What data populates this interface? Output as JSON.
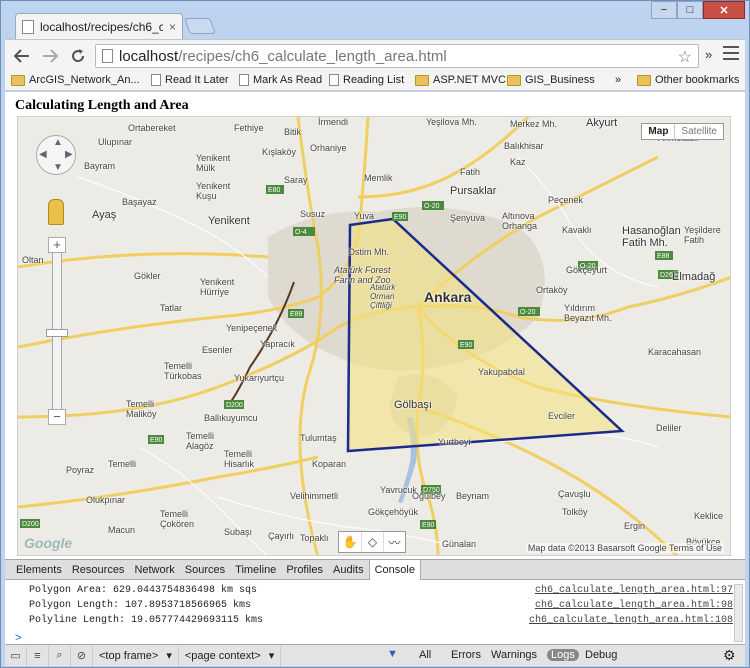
{
  "browser": {
    "tab_title": "localhost/recipes/ch6_calc",
    "tab_close": "×",
    "url_host": "localhost",
    "url_path": "/recipes/ch6_calculate_length_area.html",
    "win_min": "−",
    "win_max": "□",
    "win_close": "✕",
    "overflow_chevron": "»"
  },
  "bookmarks": [
    {
      "label": "ArcGIS_Network_An...",
      "kind": "folder"
    },
    {
      "label": "Read It Later",
      "kind": "page"
    },
    {
      "label": "Mark As Read",
      "kind": "page"
    },
    {
      "label": "Reading List",
      "kind": "page"
    },
    {
      "label": "ASP.NET MVC",
      "kind": "folder"
    },
    {
      "label": "GIS_Business",
      "kind": "folder"
    },
    {
      "label": "Other bookmarks",
      "kind": "folder"
    }
  ],
  "page": {
    "title": "Calculating Length and Area"
  },
  "map": {
    "map_type": {
      "map": "Map",
      "satellite": "Satellite"
    },
    "zoom_in": "+",
    "zoom_out": "−",
    "credit": "Map data ©2013 Basarsoft Google   Terms of Use",
    "google_logo": "Google",
    "labels": {
      "ortabereket": "Ortabereket",
      "fethiye": "Fethiye",
      "bitik": "Bitik",
      "irmendi": "İrmendi",
      "ulupinar": "Ulupınar",
      "kislakoy": "Kışlaköy",
      "orhaniye": "Orhaniye",
      "yesilova": "Yeşilova Mh.",
      "merkez": "Merkez Mh.",
      "akyurt": "Akyurt",
      "ahmetadil": "Ahmetadil",
      "bayram": "Bayram",
      "yenikent_mulk": "Yenikent Mülk",
      "memlik": "Memlik",
      "fatih": "Fatih",
      "kaz": "Kaz",
      "balikhisar": "Balıkhisar",
      "saray": "Saray",
      "yenikent_kusu": "Yenikent Kuşu",
      "pursaklar": "Pursaklar",
      "pecenek": "Peçenek",
      "basayaz": "Başayaz",
      "ayas": "Ayaş",
      "yenikent": "Yenikent",
      "susuz": "Susuz",
      "yuva": "Yuva",
      "senyuva": "Şenyuva",
      "altinova": "Altınova Orhanga",
      "kavakli": "Kavaklı",
      "hasanoglan": "Hasanoğlan Fatih Mh.",
      "yesildere": "Yeşildere Fatih",
      "oltan": "Oltan",
      "ostim": "Ostim Mh.",
      "ataturk": "Atatürk Forest Farm and Zoo",
      "ataturk2": "Atatürk Orman Çiftliği",
      "gokceoren": "Gökçeyurt",
      "gokler": "Gökler",
      "yenikent_hurriye": "Yenikent Hürriye",
      "ankara": "Ankara",
      "ortakoy": "Ortaköy",
      "elmadag": "Elmadağ",
      "tatlar": "Tatlar",
      "yildirim": "Yıldırım Beyazıt Mh.",
      "yenipecenek": "Yenipeçenek",
      "esenler": "Esenler",
      "yapracik": "Yapracık",
      "karacahasan": "Karacahasan",
      "temelli_turkobas": "Temelli Türkobas",
      "yukariyurtcu": "Yukarıyurtçu",
      "yakupabdal": "Yakupabdal",
      "temelli_malikoy": "Temelli Maliköy",
      "ballikuyumcu": "Ballıkuyumcu",
      "golbasi": "Gölbaşı",
      "evciler": "Evciler",
      "deliler": "Deliler",
      "temelli_alagoz": "Temelli Alagöz",
      "yurtbeyi": "Yurtbeyi",
      "tulumtas": "Tulumtaş",
      "poyraz": "Poyraz",
      "temelli": "Temelli",
      "temelli_hisarlik": "Temelli Hisarlık",
      "koparan": "Koparan",
      "velihimmetli": "Velihimmetli",
      "yavrucuk": "Yavrucuk",
      "ogulbey": "Oğulbey",
      "beynam": "Beynam",
      "cavuslu": "Çavuşlu",
      "olukpinar": "Olukpınar",
      "temelli_cokoren": "Temelli Çokören",
      "gokcehoyuk": "Gökçehöyük",
      "tolkoy": "Tolköy",
      "kekliçe": "Keklice",
      "macun": "Macun",
      "subasi": "Subaşı",
      "cayirli": "Çayırlı",
      "topakli": "Topaklı",
      "gunalan": "Günalan",
      "ergin": "Ergin",
      "bolukce": "Böyükce"
    },
    "draw_tools": [
      "✋",
      "◇",
      "〰"
    ]
  },
  "devtools": {
    "tabs": [
      "Elements",
      "Resources",
      "Network",
      "Sources",
      "Timeline",
      "Profiles",
      "Audits",
      "Console"
    ],
    "active_tab": "Console",
    "console_lines": [
      {
        "text": "Polygon Area: 629.0443754836498 km sqs",
        "source": "ch6_calculate_length_area.html:97"
      },
      {
        "text": "Polygon Length: 107.8953718566965 kms",
        "source": "ch6_calculate_length_area.html:98"
      },
      {
        "text": "Polyline Length: 19.057774429693115 kms",
        "source": "ch6_calculate_length_area.html:108"
      }
    ],
    "prompt": ">",
    "frame_select": "<top frame>",
    "context_select": "<page context>",
    "filters": [
      "All",
      "Errors",
      "Warnings",
      "Logs",
      "Debug"
    ],
    "active_filter": "Logs"
  },
  "colors": {
    "polygon_stroke": "#1a2b8c",
    "polygon_fill": "#f6e27a",
    "polyline_stroke": "#5a3a1e",
    "road": "#f2d26b",
    "urban": "#d9d4c8"
  }
}
